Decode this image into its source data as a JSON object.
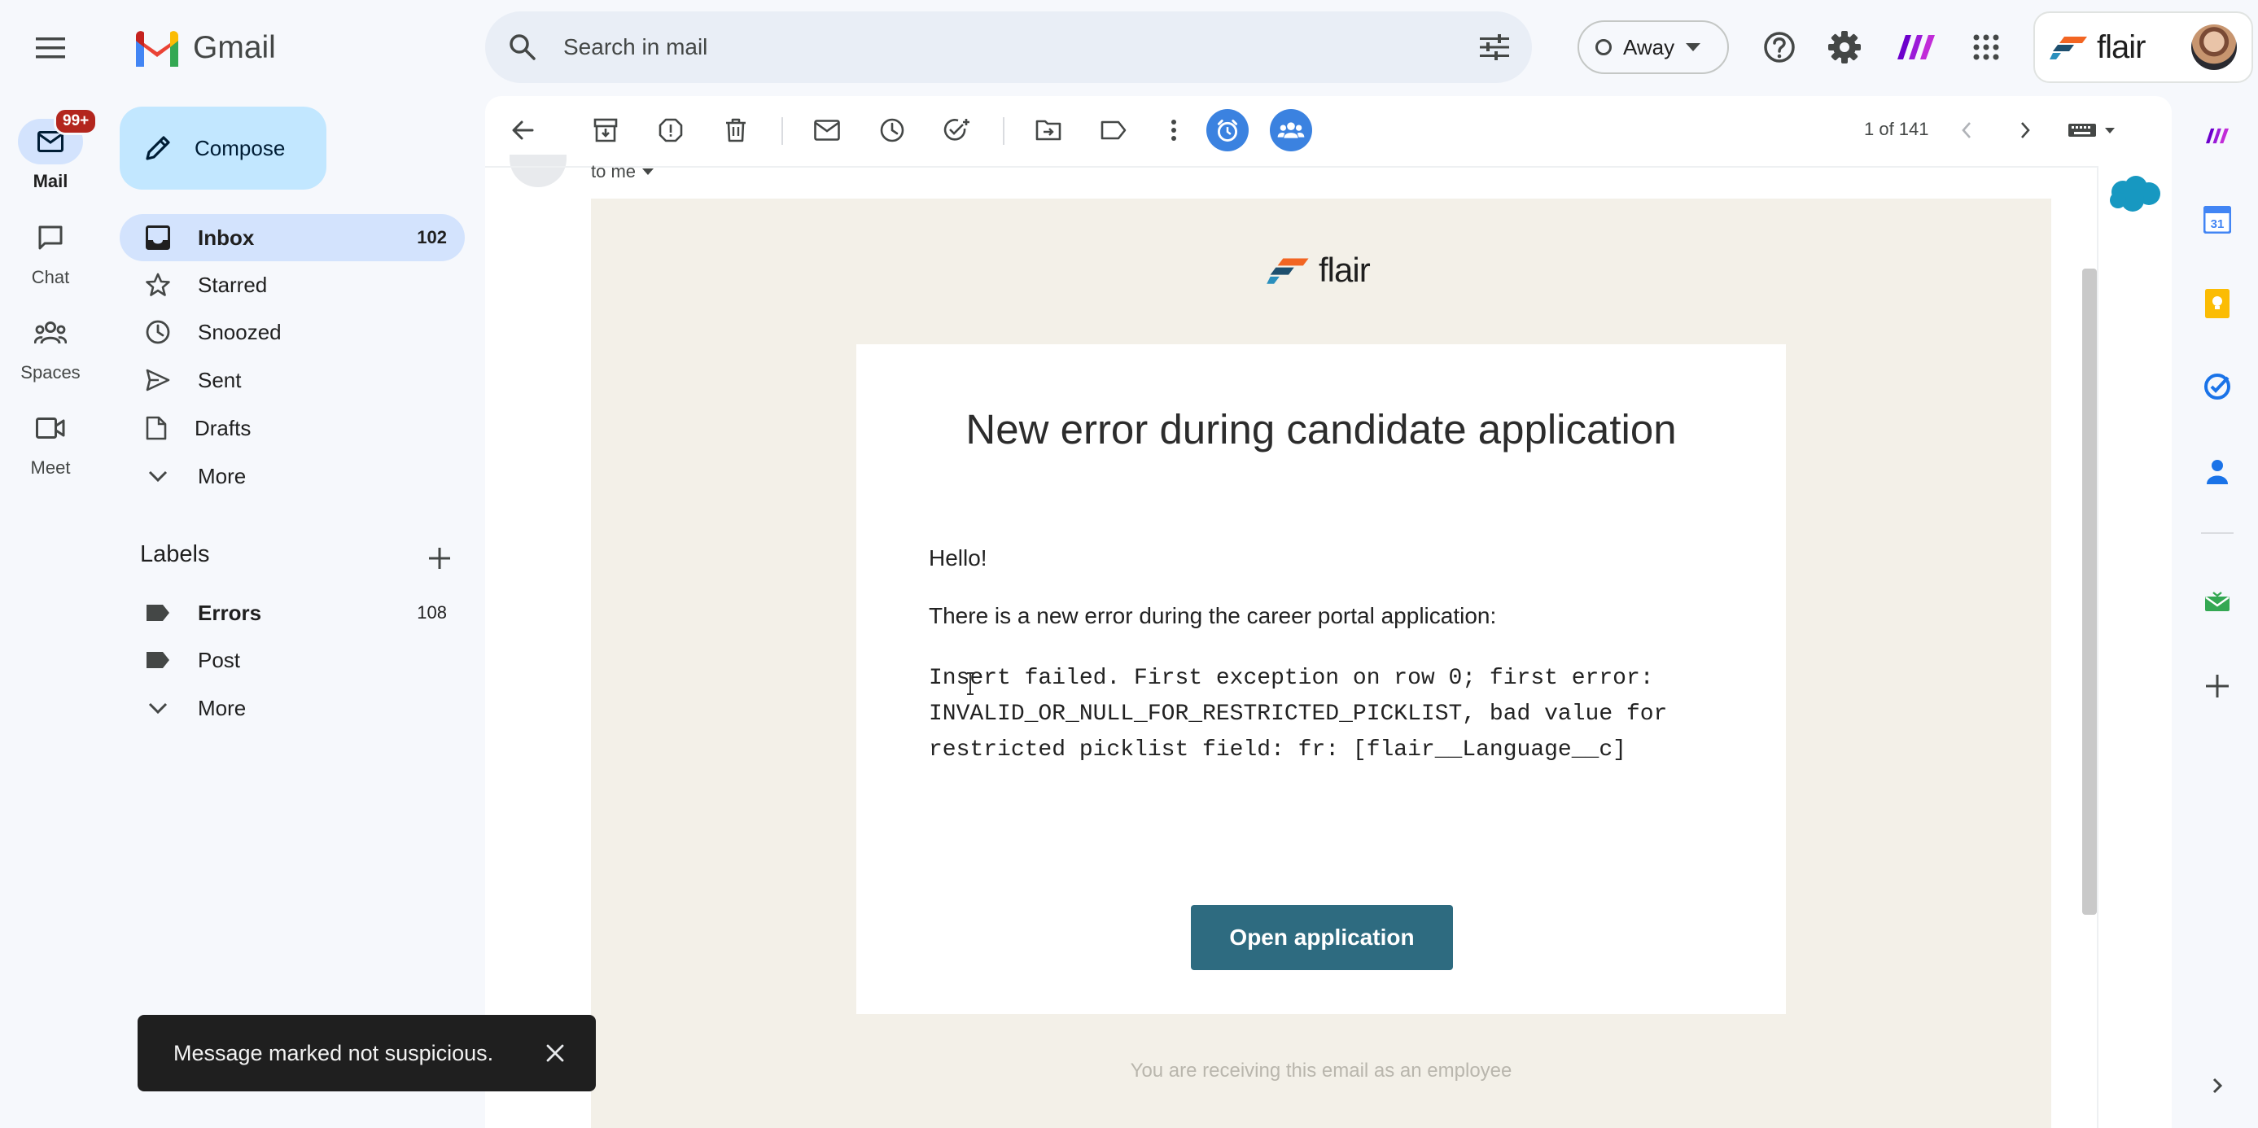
{
  "app": {
    "name": "Gmail"
  },
  "search": {
    "placeholder": "Search in mail"
  },
  "status": {
    "label": "Away"
  },
  "flair_brand": {
    "word": "flair"
  },
  "rail": [
    {
      "label": "Mail",
      "badge": "99+"
    },
    {
      "label": "Chat"
    },
    {
      "label": "Spaces"
    },
    {
      "label": "Meet"
    }
  ],
  "sidebar": {
    "compose": "Compose",
    "items": [
      {
        "label": "Inbox",
        "count": "102"
      },
      {
        "label": "Starred"
      },
      {
        "label": "Snoozed"
      },
      {
        "label": "Sent"
      },
      {
        "label": "Drafts"
      },
      {
        "label": "More"
      }
    ],
    "labels_title": "Labels",
    "labels": [
      {
        "label": "Errors",
        "count": "108"
      },
      {
        "label": "Post"
      },
      {
        "label": "More"
      }
    ]
  },
  "toolbar": {
    "pager": "1 of 141"
  },
  "message": {
    "to": "to me",
    "brand": "flair",
    "title": "New error during candidate application",
    "hello": "Hello!",
    "intro": "There is a new error during the career portal application:",
    "error_lines": [
      "Insert failed. First exception on row 0; first error:",
      "INVALID_OR_NULL_FOR_RESTRICTED_PICKLIST, bad value for",
      "restricted picklist field: fr: [flair__Language__c]"
    ],
    "button": "Open application",
    "footer": "You are receiving this email as an employee"
  },
  "snackbar": {
    "text": "Message marked not suspicious."
  },
  "colors": {
    "accent": "#0b57d0",
    "compose_bg": "#c2e7ff",
    "active_nav": "#d3e3fd",
    "email_button": "#2e6b80",
    "badge": "#b3261e"
  }
}
